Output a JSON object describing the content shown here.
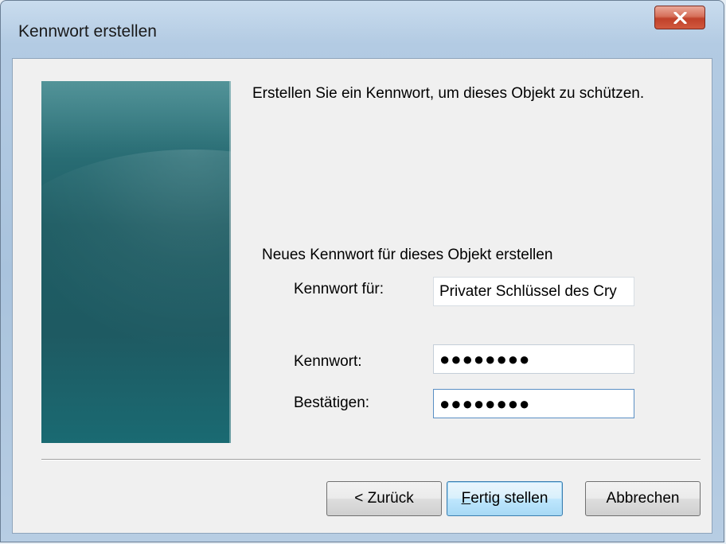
{
  "window": {
    "title": "Kennwort erstellen"
  },
  "content": {
    "instruction": "Erstellen Sie ein Kennwort, um dieses Objekt zu schützen.",
    "section_label": "Neues Kennwort für dieses Objekt erstellen",
    "fields": {
      "password_for_label": "Kennwort für:",
      "password_for_value": "Privater Schlüssel des Cry",
      "password_label": "Kennwort:",
      "password_value": "●●●●●●●●",
      "confirm_label": "Bestätigen:",
      "confirm_value": "●●●●●●●●"
    }
  },
  "buttons": {
    "back": "< Zurück",
    "finish": "Fertig stellen",
    "cancel": "Abbrechen"
  },
  "icons": {
    "close": "close-icon"
  },
  "colors": {
    "banner": "#1f5d64",
    "close_button": "#c0412a",
    "default_button_border": "#3c7fb1"
  }
}
